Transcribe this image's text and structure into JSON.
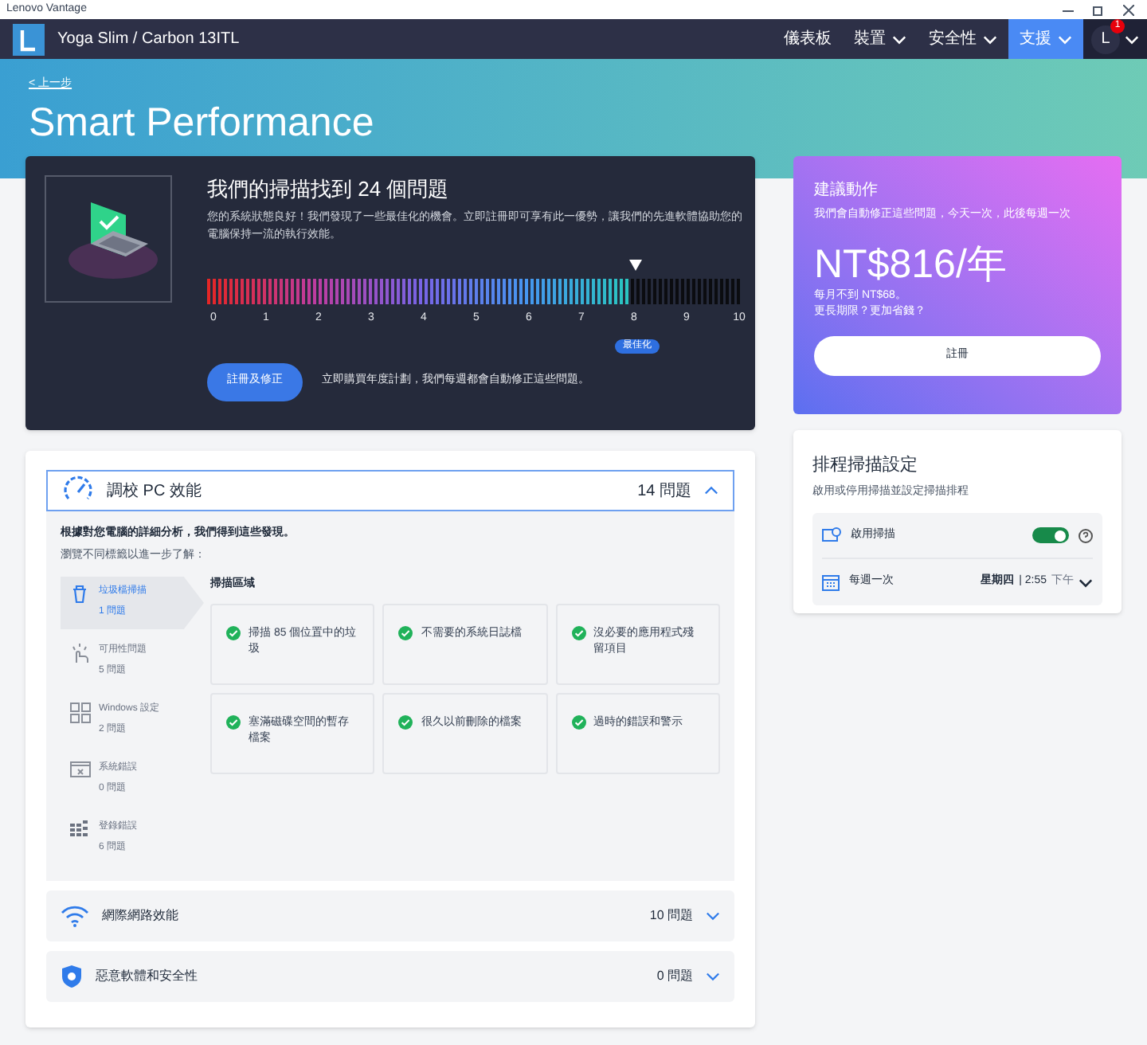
{
  "window": {
    "title": "Lenovo Vantage"
  },
  "nav": {
    "device": "Yoga Slim / Carbon 13ITL",
    "avatar": "L",
    "badge": "1",
    "items": [
      {
        "label": "儀表板",
        "dropdown": false,
        "selected": false
      },
      {
        "label": "裝置",
        "dropdown": true,
        "selected": false
      },
      {
        "label": "安全性",
        "dropdown": true,
        "selected": false
      },
      {
        "label": "支援",
        "dropdown": true,
        "selected": true
      }
    ]
  },
  "header": {
    "back": "< 上一步",
    "title": "Smart Performance"
  },
  "scan": {
    "title": "我們的掃描找到 24 個問題",
    "description": "您的系統狀態良好！我們發現了一些最佳化的機會。立即註冊即可享有此一優勢，讓我們的先進軟體協助您的電腦保持一流的執行效能。",
    "level": 0.8,
    "scale": [
      "0",
      "1",
      "2",
      "3",
      "4",
      "5",
      "6",
      "7",
      "8",
      "9",
      "10"
    ],
    "marker_label": "最佳化",
    "button": "註冊及修正",
    "note": "立即購買年度計劃，我們每週都會自動修正這些問題。"
  },
  "offer": {
    "title": "建議動作",
    "subtitle": "我們會自動修正這些問題，今天一次，此後每週一次",
    "price": "NT$816/年",
    "lines": [
      "每月不到 NT$68。",
      "更長期限？更加省錢？"
    ],
    "button": "註冊"
  },
  "schedule": {
    "title": "排程掃描設定",
    "subtitle": "啟用或停用掃描並設定掃描排程",
    "enable_label": "啟用掃描",
    "on": true,
    "frequency": "每週一次",
    "day": "星期四",
    "separator": "|",
    "time": "2:55",
    "ampm": "下午"
  },
  "sections": [
    {
      "kind": "tune",
      "title": "調校 PC 效能",
      "count": "14",
      "unit": "問題",
      "expanded": true,
      "intro": "根據對您電腦的詳細分析，我們得到這些發現。",
      "hint": "瀏覽不同標籤以進一步了解：",
      "tabs": [
        {
          "kind": "trash",
          "label": "垃圾檔掃描",
          "count": "1 問題",
          "selected": true
        },
        {
          "kind": "hand",
          "label": "可用性問題",
          "count": "5 問題",
          "selected": false
        },
        {
          "kind": "windows",
          "label": "Windows 設定",
          "count": "2 問題",
          "selected": false
        },
        {
          "kind": "error",
          "label": "系統錯誤",
          "count": "0 問題",
          "selected": false
        },
        {
          "kind": "registry",
          "label": "登錄錯誤",
          "count": "6 問題",
          "selected": false
        }
      ],
      "area_title": "掃描區域",
      "items": [
        "掃描 85 個位置中的垃圾",
        "不需要的系統日誌檔",
        "沒必要的應用程式殘留項目",
        "塞滿磁碟空間的暫存檔案",
        "很久以前刪除的檔案",
        "過時的錯誤和警示"
      ]
    },
    {
      "kind": "wifi",
      "title": "網際網路效能",
      "count": "10",
      "unit": "問題",
      "expanded": false
    },
    {
      "kind": "shield",
      "title": "惡意軟體和安全性",
      "count": "0",
      "unit": "問題",
      "expanded": false
    }
  ]
}
